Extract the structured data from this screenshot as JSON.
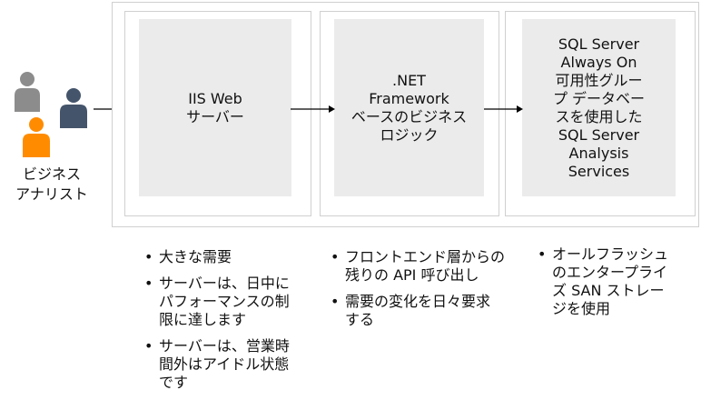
{
  "actor": {
    "label": "ビジネス\nアナリスト",
    "icon": "people-icon",
    "colors": {
      "gray": "#8c8c8c",
      "blue": "#44546a",
      "orange": "#ff8c00"
    }
  },
  "tiers": [
    {
      "label": "IIS Web\nサーバー"
    },
    {
      "label": ".NET\nFramework\nベースのビジネス\nロジック"
    },
    {
      "label": "SQL Server\nAlways On\n可用性グルー\nプ データベー\nスを使用した\nSQL Server\nAnalysis\nServices"
    }
  ],
  "notes": [
    [
      "大きな需要",
      "サーバーは、日中に\nパフォーマンスの制\n限に達します",
      "サーバーは、営業時\n間外はアイドル状態\nです"
    ],
    [
      "フロントエンド層からの\n残りの API 呼び出し",
      "需要の変化を日々要求\nする"
    ],
    [
      "オールフラッシュ\nのエンタープライ\nズ SAN ストレー\nジを使用"
    ]
  ],
  "colors": {
    "box_fill": "#ebebeb",
    "border": "#d0d0d0",
    "arrow": "#000000"
  }
}
